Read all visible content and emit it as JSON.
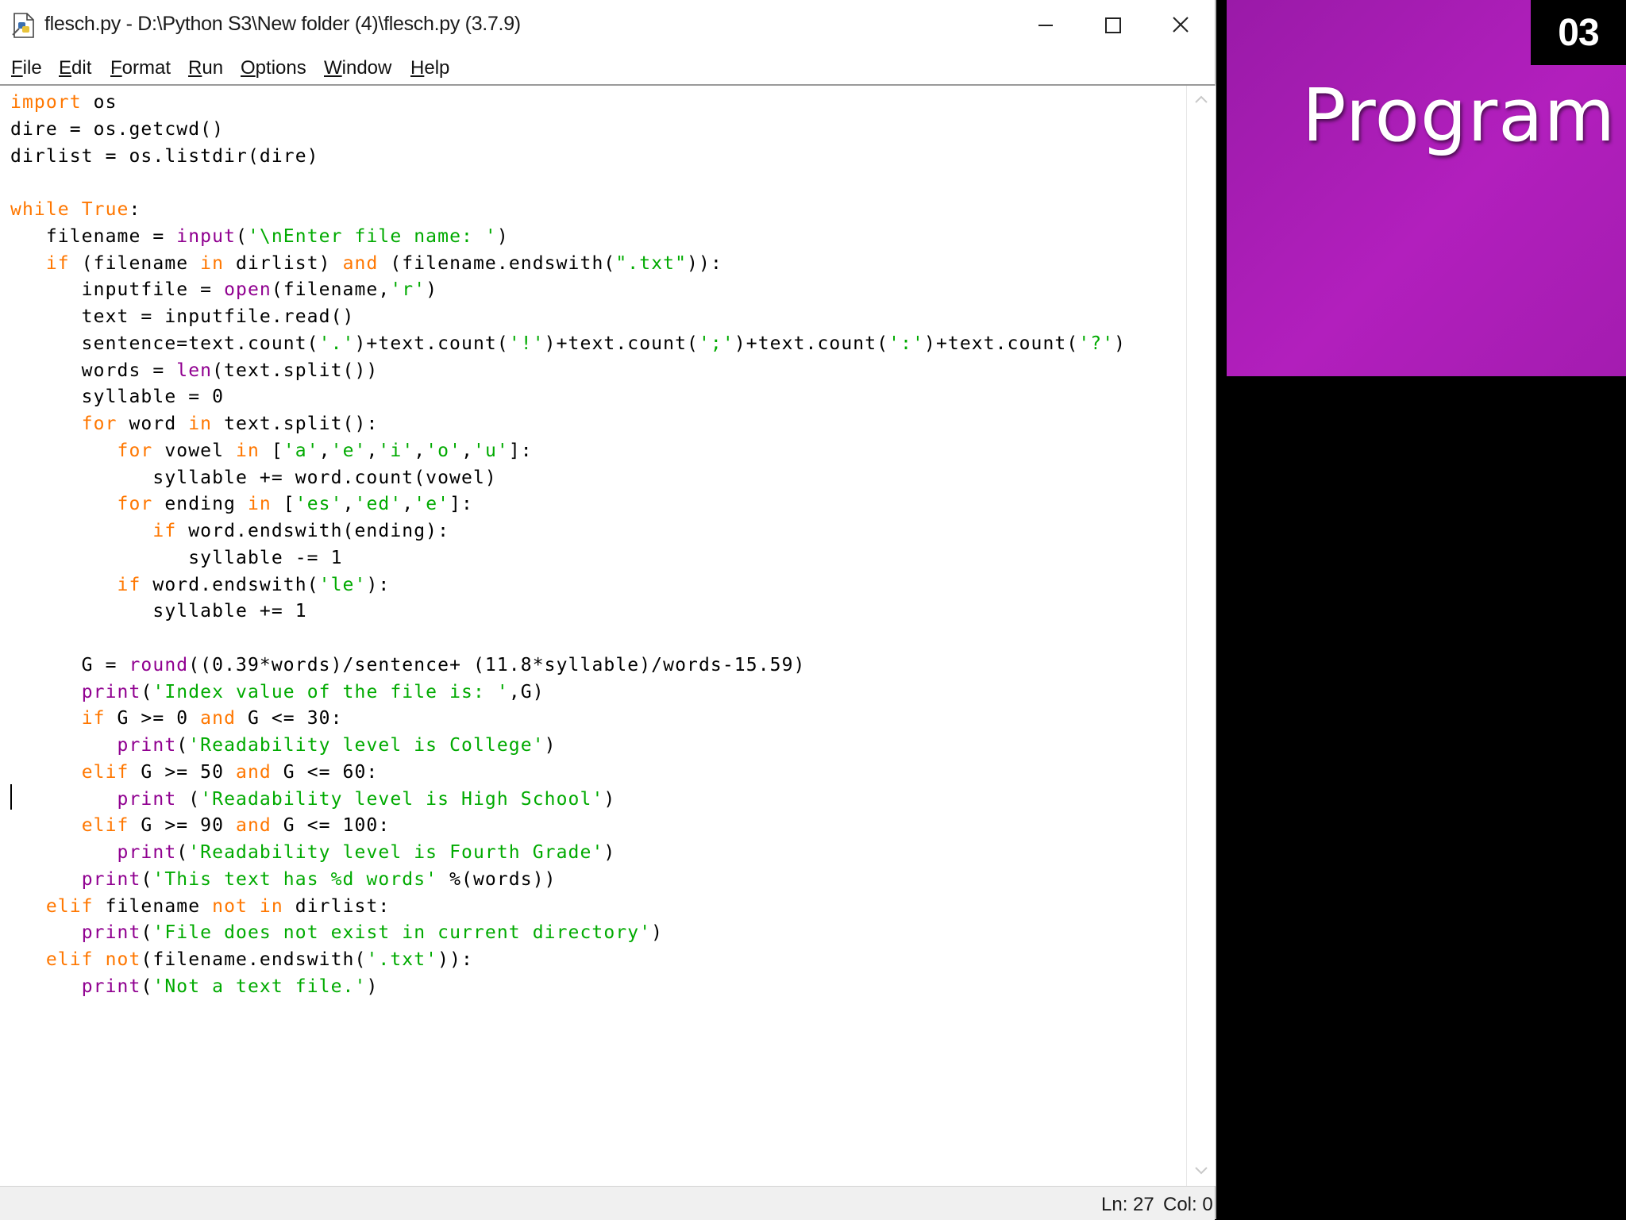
{
  "window": {
    "title": "flesch.py - D:\\Python S3\\New folder (4)\\flesch.py (3.7.9)"
  },
  "menu": [
    {
      "label": "File"
    },
    {
      "label": "Edit"
    },
    {
      "label": "Format"
    },
    {
      "label": "Run"
    },
    {
      "label": "Options"
    },
    {
      "label": "Window"
    },
    {
      "label": "Help"
    }
  ],
  "code_lines": [
    [
      {
        "t": "import",
        "c": "kw"
      },
      {
        "t": " os"
      }
    ],
    [
      {
        "t": "dire = os.getcwd()"
      }
    ],
    [
      {
        "t": "dirlist = os.listdir(dire)"
      }
    ],
    [
      {
        "t": ""
      }
    ],
    [
      {
        "t": "while",
        "c": "kw"
      },
      {
        "t": " "
      },
      {
        "t": "True",
        "c": "kw"
      },
      {
        "t": ":"
      }
    ],
    [
      {
        "t": "   filename = "
      },
      {
        "t": "input",
        "c": "bi"
      },
      {
        "t": "("
      },
      {
        "t": "'\\nEnter file name: '",
        "c": "str"
      },
      {
        "t": ")"
      }
    ],
    [
      {
        "t": "   "
      },
      {
        "t": "if",
        "c": "kw"
      },
      {
        "t": " (filename "
      },
      {
        "t": "in",
        "c": "kw"
      },
      {
        "t": " dirlist) "
      },
      {
        "t": "and",
        "c": "kw"
      },
      {
        "t": " (filename.endswith("
      },
      {
        "t": "\".txt\"",
        "c": "str"
      },
      {
        "t": ")):"
      }
    ],
    [
      {
        "t": "      inputfile = "
      },
      {
        "t": "open",
        "c": "bi"
      },
      {
        "t": "(filename,"
      },
      {
        "t": "'r'",
        "c": "str"
      },
      {
        "t": ")"
      }
    ],
    [
      {
        "t": "      text = inputfile.read()"
      }
    ],
    [
      {
        "t": "      sentence=text.count("
      },
      {
        "t": "'.'",
        "c": "str"
      },
      {
        "t": ")+text.count("
      },
      {
        "t": "'!'",
        "c": "str"
      },
      {
        "t": ")+text.count("
      },
      {
        "t": "';'",
        "c": "str"
      },
      {
        "t": ")+text.count("
      },
      {
        "t": "':'",
        "c": "str"
      },
      {
        "t": ")+text.count("
      },
      {
        "t": "'?'",
        "c": "str"
      },
      {
        "t": ")"
      }
    ],
    [
      {
        "t": "      words = "
      },
      {
        "t": "len",
        "c": "bi"
      },
      {
        "t": "(text.split())"
      }
    ],
    [
      {
        "t": "      syllable = 0"
      }
    ],
    [
      {
        "t": "      "
      },
      {
        "t": "for",
        "c": "kw"
      },
      {
        "t": " word "
      },
      {
        "t": "in",
        "c": "kw"
      },
      {
        "t": " text.split():"
      }
    ],
    [
      {
        "t": "         "
      },
      {
        "t": "for",
        "c": "kw"
      },
      {
        "t": " vowel "
      },
      {
        "t": "in",
        "c": "kw"
      },
      {
        "t": " ["
      },
      {
        "t": "'a'",
        "c": "str"
      },
      {
        "t": ","
      },
      {
        "t": "'e'",
        "c": "str"
      },
      {
        "t": ","
      },
      {
        "t": "'i'",
        "c": "str"
      },
      {
        "t": ","
      },
      {
        "t": "'o'",
        "c": "str"
      },
      {
        "t": ","
      },
      {
        "t": "'u'",
        "c": "str"
      },
      {
        "t": "]:"
      }
    ],
    [
      {
        "t": "            syllable += word.count(vowel)"
      }
    ],
    [
      {
        "t": "         "
      },
      {
        "t": "for",
        "c": "kw"
      },
      {
        "t": " ending "
      },
      {
        "t": "in",
        "c": "kw"
      },
      {
        "t": " ["
      },
      {
        "t": "'es'",
        "c": "str"
      },
      {
        "t": ","
      },
      {
        "t": "'ed'",
        "c": "str"
      },
      {
        "t": ","
      },
      {
        "t": "'e'",
        "c": "str"
      },
      {
        "t": "]:"
      }
    ],
    [
      {
        "t": "            "
      },
      {
        "t": "if",
        "c": "kw"
      },
      {
        "t": " word.endswith(ending):"
      }
    ],
    [
      {
        "t": "               syllable -= 1"
      }
    ],
    [
      {
        "t": "         "
      },
      {
        "t": "if",
        "c": "kw"
      },
      {
        "t": " word.endswith("
      },
      {
        "t": "'le'",
        "c": "str"
      },
      {
        "t": "):"
      }
    ],
    [
      {
        "t": "            syllable += 1"
      }
    ],
    [
      {
        "t": ""
      }
    ],
    [
      {
        "t": "      G = "
      },
      {
        "t": "round",
        "c": "bi"
      },
      {
        "t": "((0.39*words)/sentence+ (11.8*syllable)/words-15.59)"
      }
    ],
    [
      {
        "t": "      "
      },
      {
        "t": "print",
        "c": "bi"
      },
      {
        "t": "("
      },
      {
        "t": "'Index value of the file is: '",
        "c": "str"
      },
      {
        "t": ",G)"
      }
    ],
    [
      {
        "t": "      "
      },
      {
        "t": "if",
        "c": "kw"
      },
      {
        "t": " G >= 0 "
      },
      {
        "t": "and",
        "c": "kw"
      },
      {
        "t": " G <= 30:"
      }
    ],
    [
      {
        "t": "         "
      },
      {
        "t": "print",
        "c": "bi"
      },
      {
        "t": "("
      },
      {
        "t": "'Readability level is College'",
        "c": "str"
      },
      {
        "t": ")"
      }
    ],
    [
      {
        "t": "      "
      },
      {
        "t": "elif",
        "c": "kw"
      },
      {
        "t": " G >= 50 "
      },
      {
        "t": "and",
        "c": "kw"
      },
      {
        "t": " G <= 60:"
      }
    ],
    [
      {
        "t": "         "
      },
      {
        "t": "print",
        "c": "bi"
      },
      {
        "t": " ("
      },
      {
        "t": "'Readability level is High School'",
        "c": "str"
      },
      {
        "t": ")"
      }
    ],
    [
      {
        "t": "      "
      },
      {
        "t": "elif",
        "c": "kw"
      },
      {
        "t": " G >= 90 "
      },
      {
        "t": "and",
        "c": "kw"
      },
      {
        "t": " G <= 100:"
      }
    ],
    [
      {
        "t": "         "
      },
      {
        "t": "print",
        "c": "bi"
      },
      {
        "t": "("
      },
      {
        "t": "'Readability level is Fourth Grade'",
        "c": "str"
      },
      {
        "t": ")"
      }
    ],
    [
      {
        "t": "      "
      },
      {
        "t": "print",
        "c": "bi"
      },
      {
        "t": "("
      },
      {
        "t": "'This text has %d words'",
        "c": "str"
      },
      {
        "t": " %(words))"
      }
    ],
    [
      {
        "t": "   "
      },
      {
        "t": "elif",
        "c": "kw"
      },
      {
        "t": " filename "
      },
      {
        "t": "not",
        "c": "kw"
      },
      {
        "t": " "
      },
      {
        "t": "in",
        "c": "kw"
      },
      {
        "t": " dirlist:"
      }
    ],
    [
      {
        "t": "      "
      },
      {
        "t": "print",
        "c": "bi"
      },
      {
        "t": "("
      },
      {
        "t": "'File does not exist in current directory'",
        "c": "str"
      },
      {
        "t": ")"
      }
    ],
    [
      {
        "t": "   "
      },
      {
        "t": "elif",
        "c": "kw"
      },
      {
        "t": " "
      },
      {
        "t": "not",
        "c": "kw"
      },
      {
        "t": "(filename.endswith("
      },
      {
        "t": "'.txt'",
        "c": "str"
      },
      {
        "t": ")):"
      }
    ],
    [
      {
        "t": "      "
      },
      {
        "t": "print",
        "c": "bi"
      },
      {
        "t": "("
      },
      {
        "t": "'Not a text file.'",
        "c": "str"
      },
      {
        "t": ")"
      }
    ]
  ],
  "status": {
    "line": "Ln: 27",
    "col": "Col: 0"
  },
  "slide": {
    "number": "03",
    "title": "Program"
  },
  "colors": {
    "keyword": "#ff7700",
    "builtin": "#900090",
    "string": "#00aa00",
    "panel_purple": "#b21fbd"
  },
  "icons": [
    "python-file-icon",
    "minimize-icon",
    "maximize-icon",
    "close-icon",
    "scroll-up-arrow-icon",
    "scroll-down-arrow-icon"
  ]
}
